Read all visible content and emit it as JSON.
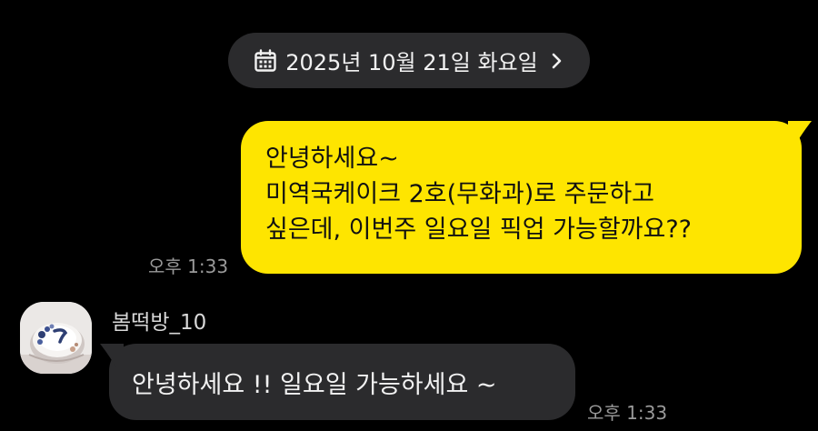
{
  "date_divider": {
    "text": "2025년 10월 21일 화요일",
    "icon": "calendar-icon",
    "chevron": "chevron-right-icon"
  },
  "messages": {
    "outgoing": {
      "lines": [
        "안녕하세요~",
        "미역국케이크 2호(무화과)로 주문하고",
        "싶은데,  이번주 일요일 픽업 가능할까요??"
      ],
      "time": "오후 1:33",
      "bubble_color": "#fee500"
    },
    "incoming": {
      "sender": "봄떡방_10",
      "text": "안녕하세요 !! 일요일 가능하세요 ~",
      "time": "오후 1:33",
      "bubble_color": "#2b2b2d"
    }
  },
  "theme": {
    "background": "#000000",
    "timestamp_color": "#9a9a9a"
  }
}
